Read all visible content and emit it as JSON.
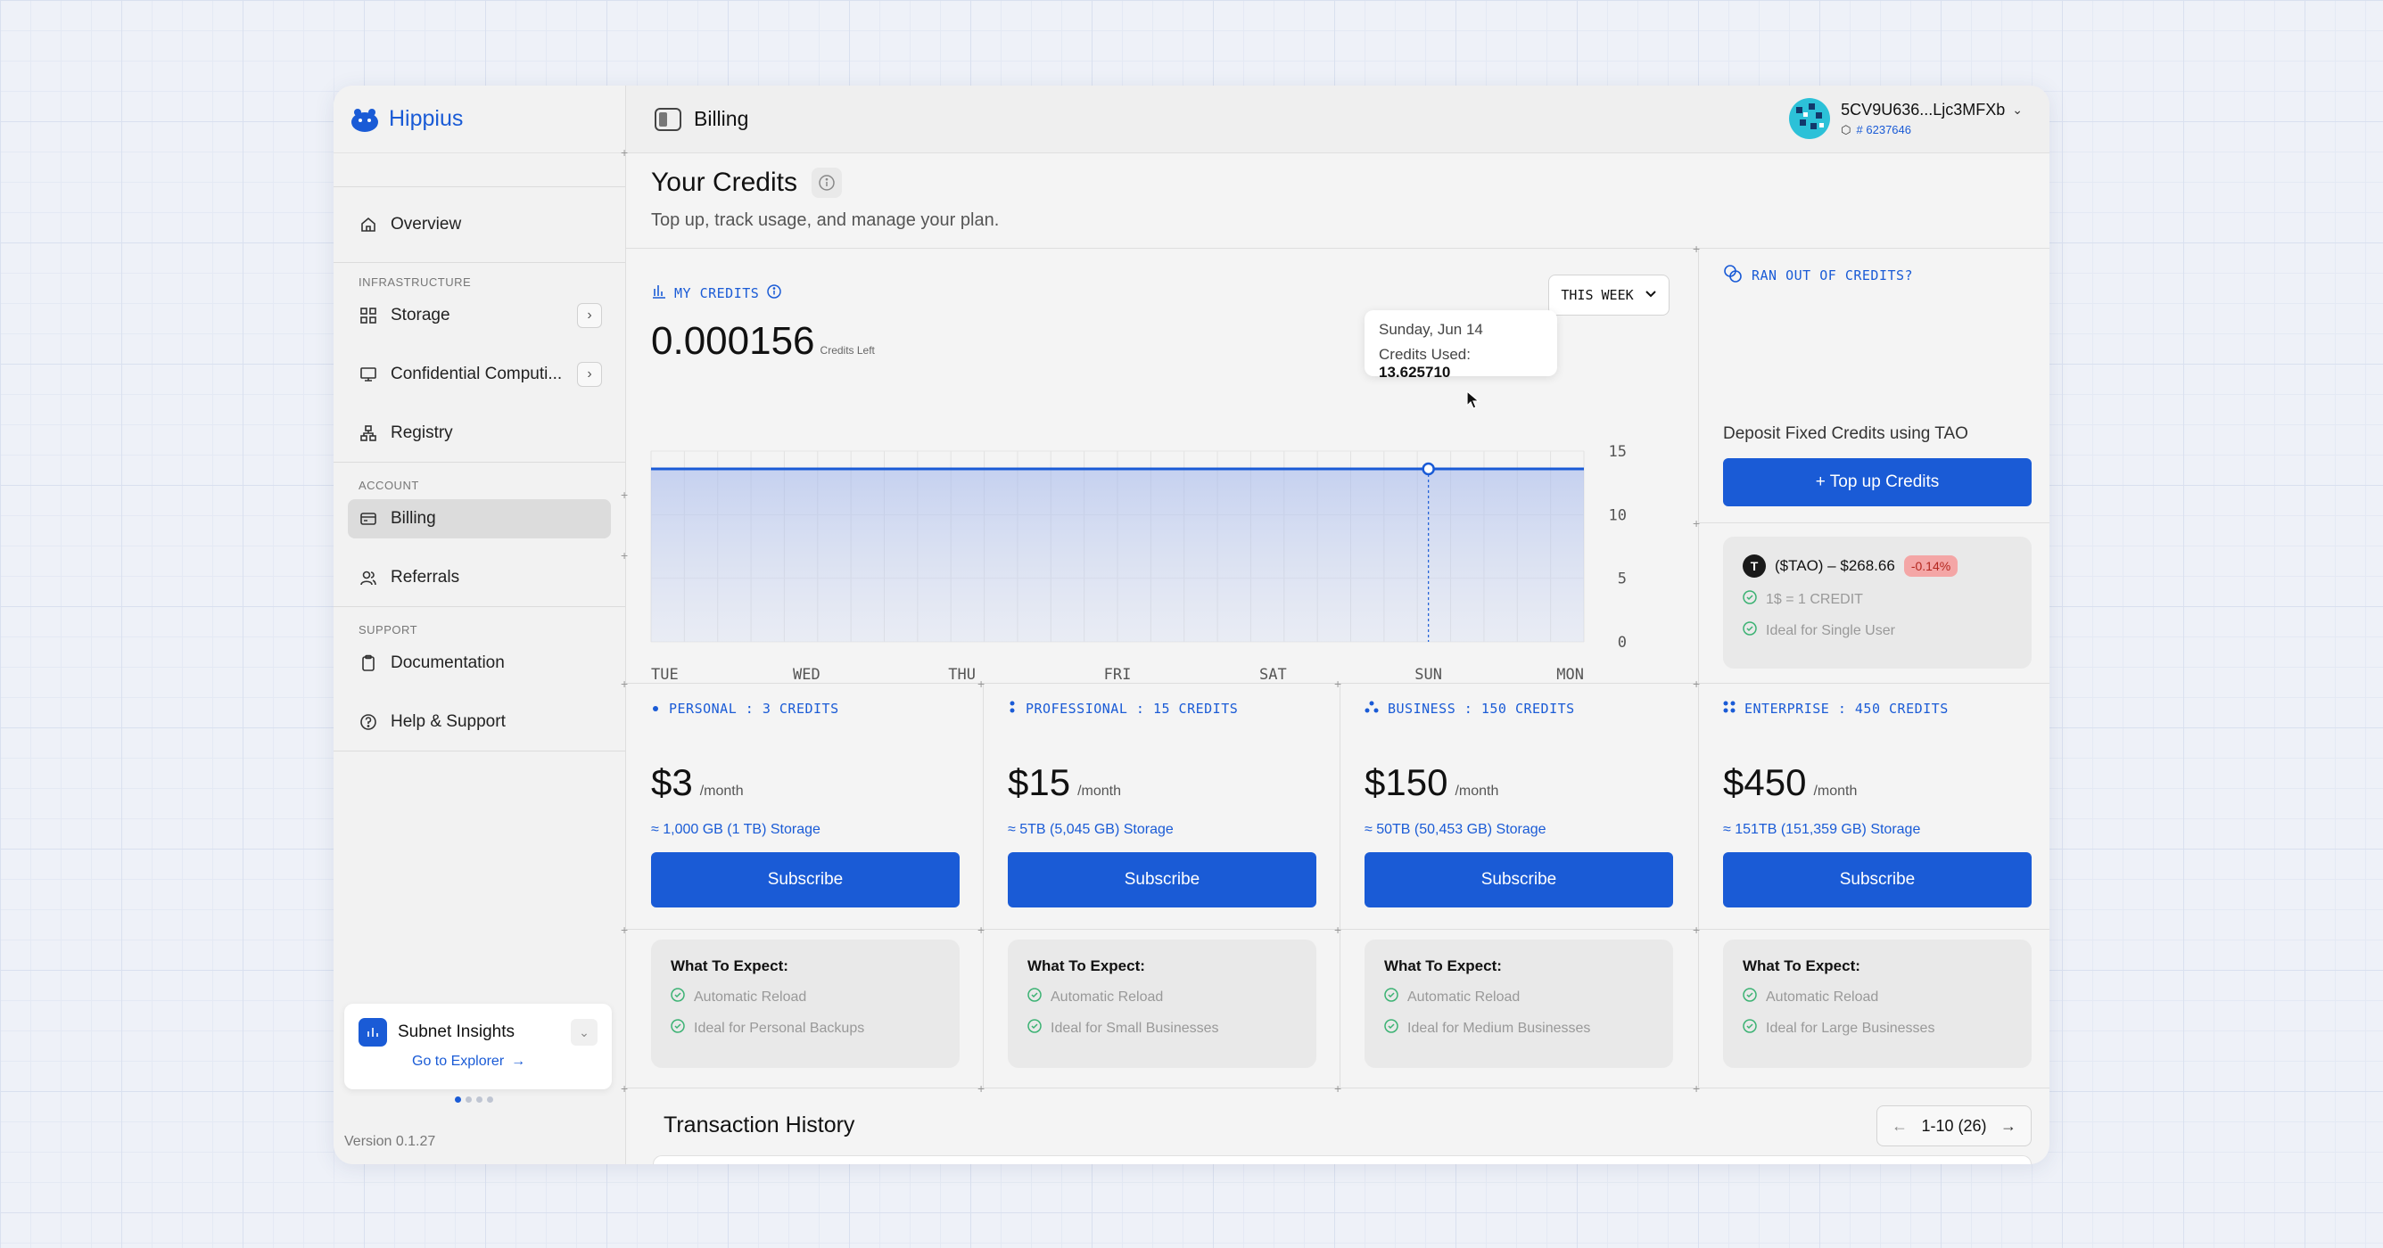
{
  "app": {
    "name": "Hippius"
  },
  "sidebar": {
    "top_items": [
      {
        "label": "Overview",
        "icon": "home-icon"
      }
    ],
    "infrastructure": {
      "label": "INFRASTRUCTURE",
      "items": [
        {
          "label": "Storage",
          "icon": "grid-icon",
          "has_chevron": true
        },
        {
          "label": "Confidential Computi...",
          "icon": "monitor-icon",
          "has_chevron": true
        },
        {
          "label": "Registry",
          "icon": "registry-icon",
          "has_chevron": false
        }
      ]
    },
    "account": {
      "label": "ACCOUNT",
      "items": [
        {
          "label": "Billing",
          "icon": "card-icon",
          "active": true
        },
        {
          "label": "Referrals",
          "icon": "users-icon"
        }
      ]
    },
    "support": {
      "label": "SUPPORT",
      "items": [
        {
          "label": "Documentation",
          "icon": "clipboard-icon"
        },
        {
          "label": "Help & Support",
          "icon": "help-icon"
        }
      ]
    },
    "insights": {
      "title": "Subnet Insights",
      "link": "Go to Explorer"
    },
    "version": "Version 0.1.27"
  },
  "header": {
    "title": "Billing",
    "account_name": "5CV9U636...Ljc3MFXb",
    "account_sub": "# 6237646"
  },
  "page": {
    "title": "Your Credits",
    "subtitle": "Top up, track usage, and manage your plan."
  },
  "credits_chart": {
    "label": "MY CREDITS",
    "value": "0.000156",
    "value_caption": "Credits Left",
    "range_button": "THIS WEEK",
    "tooltip": {
      "date": "Sunday, Jun 14",
      "label": "Credits Used:",
      "value": "13.625710"
    }
  },
  "chart_data": {
    "type": "area",
    "x": [
      "TUE",
      "WED",
      "THU",
      "FRI",
      "SAT",
      "SUN",
      "MON"
    ],
    "series": [
      {
        "values": [
          13.6,
          13.6,
          13.6,
          13.6,
          13.6,
          13.6,
          13.6
        ]
      }
    ],
    "ylim": [
      0,
      15
    ],
    "yticks": [
      0,
      5,
      10,
      15
    ],
    "highlight_index": 5,
    "grid": true
  },
  "right_panel": {
    "heading": "RAN OUT OF CREDITS?",
    "deposit_label": "Deposit Fixed Credits using TAO",
    "topup_button": "+ Top up Credits",
    "tao_price": "($TAO) – $268.66",
    "tao_change": "-0.14%",
    "checks": [
      "1$ = 1 CREDIT",
      "Ideal for Single User"
    ]
  },
  "plans": [
    {
      "name": "PERSONAL : 3 CREDITS",
      "price": "$3",
      "period": "/month",
      "storage": "≈ 1,000 GB (1 TB) Storage",
      "button": "Subscribe",
      "expect_title": "What To Expect:",
      "features": [
        "Automatic Reload",
        "Ideal for Personal Backups"
      ]
    },
    {
      "name": "PROFESSIONAL : 15 CREDITS",
      "price": "$15",
      "period": "/month",
      "storage": "≈ 5TB (5,045 GB) Storage",
      "button": "Subscribe",
      "expect_title": "What To Expect:",
      "features": [
        "Automatic Reload",
        "Ideal for Small Businesses"
      ]
    },
    {
      "name": "BUSINESS : 150 CREDITS",
      "price": "$150",
      "period": "/month",
      "storage": "≈ 50TB (50,453 GB) Storage",
      "button": "Subscribe",
      "expect_title": "What To Expect:",
      "features": [
        "Automatic Reload",
        "Ideal for Medium Businesses"
      ]
    },
    {
      "name": "ENTERPRISE : 450 CREDITS",
      "price": "$450",
      "period": "/month",
      "storage": "≈ 151TB (151,359 GB) Storage",
      "button": "Subscribe",
      "expect_title": "What To Expect:",
      "features": [
        "Automatic Reload",
        "Ideal for Large Businesses"
      ]
    }
  ],
  "transactions": {
    "title": "Transaction History",
    "pager": "1-10 (26)"
  },
  "colors": {
    "accent": "#1a5bd6",
    "danger": "#b3261e",
    "success": "#3bb273"
  }
}
